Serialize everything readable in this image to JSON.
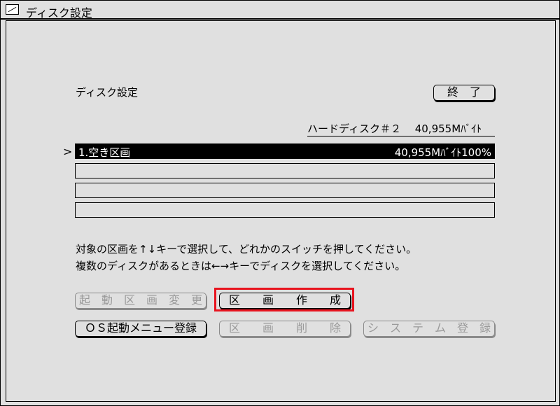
{
  "window": {
    "title": "ディスク設定"
  },
  "page": {
    "heading": "ディスク設定",
    "quit_label": "終　了"
  },
  "disk": {
    "label": "ハードディスク＃２　 40,955Mﾊﾞｲﾄ"
  },
  "partitions": {
    "cursor": ">",
    "slots": [
      {
        "label": "1.空き区画",
        "value": "40,955Mﾊﾞｲﾄ100%"
      },
      {
        "label": "",
        "value": ""
      },
      {
        "label": "",
        "value": ""
      },
      {
        "label": "",
        "value": ""
      }
    ]
  },
  "messages": {
    "line1": "対象の区画を↑↓キーで選択して、どれかのスイッチを押してください。",
    "line2": "複数のディスクがあるときは←→キーでディスクを選択してください。"
  },
  "buttons": {
    "change_boot": "起　動　区　画　変　更",
    "create_partition": "区　　画　　作　　成",
    "os_menu_register": "ＯＳ起動メニュー登録",
    "delete_partition": "区　　画　　削　　除",
    "system_register": "シ　ス　テ　ム　登　録"
  },
  "colors": {
    "highlight": "#e8141f",
    "background": "#e0e0e0",
    "selected_row": "#000000"
  }
}
